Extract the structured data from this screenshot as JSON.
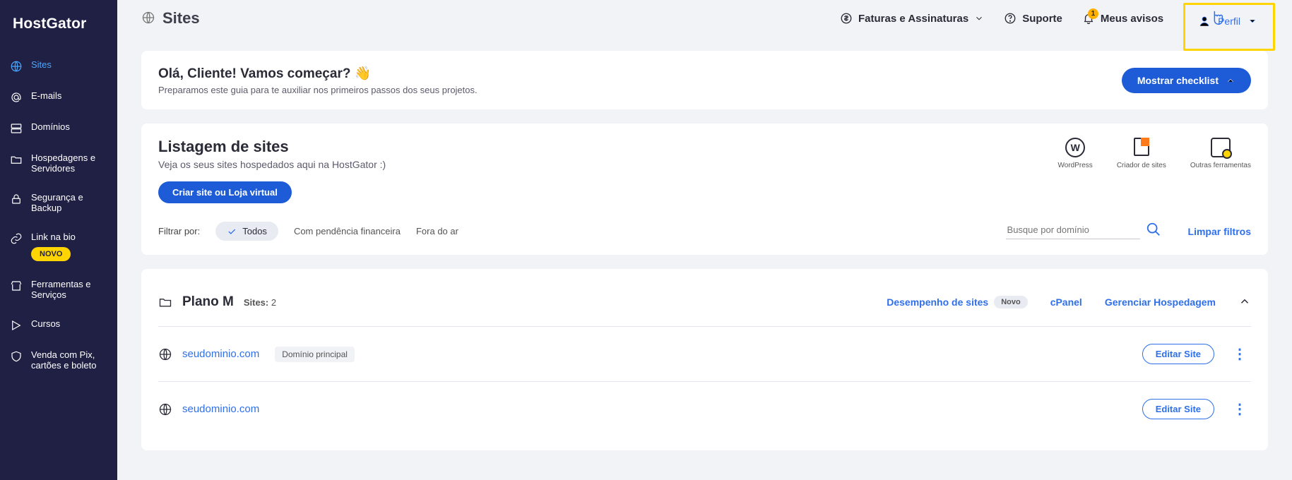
{
  "brand": "HostGator",
  "sidebar": {
    "items": [
      {
        "label": "Sites"
      },
      {
        "label": "E-mails"
      },
      {
        "label": "Domínios"
      },
      {
        "label": "Hospedagens e Servidores"
      },
      {
        "label": "Segurança e Backup"
      },
      {
        "label": "Link na bio",
        "badge": "NOVO"
      },
      {
        "label": "Ferramentas e Serviços"
      },
      {
        "label": "Cursos"
      },
      {
        "label": "Venda com Pix, cartões e boleto"
      }
    ]
  },
  "topbar": {
    "title": "Sites",
    "billing": "Faturas e Assinaturas",
    "support": "Suporte",
    "notices": "Meus avisos",
    "notices_count": "1",
    "profile": "Perfil"
  },
  "welcome": {
    "title": "Olá, Cliente! Vamos começar? 👋",
    "subtitle": "Preparamos este guia para te auxiliar nos primeiros passos dos seus projetos.",
    "button": "Mostrar checklist"
  },
  "listing": {
    "title": "Listagem de sites",
    "subtitle": "Veja os seus sites hospedados aqui na HostGator :)",
    "create_button": "Criar site ou Loja virtual",
    "quick": {
      "wordpress": "WordPress",
      "builder": "Criador de sites",
      "tools": "Outras ferramentas"
    }
  },
  "filters": {
    "label": "Filtrar por:",
    "all": "Todos",
    "pending": "Com pendência financeira",
    "offline": "Fora do ar",
    "search_placeholder": "Busque por domínio",
    "clear": "Limpar filtros"
  },
  "plan": {
    "name": "Plano M",
    "sites_label": "Sites:",
    "sites_count": "2",
    "perf": "Desempenho de sites",
    "perf_badge": "Novo",
    "cpanel": "cPanel",
    "manage": "Gerenciar Hospedagem",
    "edit_label": "Editar Site",
    "principal_tag": "Domínio principal",
    "sites": [
      {
        "domain": "seudominio.com",
        "principal": true
      },
      {
        "domain": "seudominio.com",
        "principal": false
      }
    ]
  }
}
